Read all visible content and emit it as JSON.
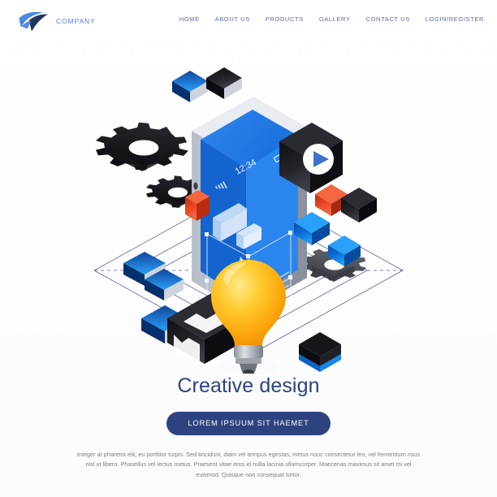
{
  "brand": {
    "logo_icon": "wing-swoosh-logo",
    "name": "COMPANY",
    "logo_color_light": "#3a7de0",
    "logo_color_dark": "#1f3566"
  },
  "nav": {
    "items": [
      {
        "label": "HOME"
      },
      {
        "label": "ABOUT US"
      },
      {
        "label": "PRODUCTS"
      },
      {
        "label": "GALLERY"
      },
      {
        "label": "CONTACT US"
      },
      {
        "label": "LOGIN/REGISTER"
      }
    ]
  },
  "hero": {
    "illustration_name": "isometric-creative-design-phone",
    "phone": {
      "status_time": "12:34",
      "signal_icon": "signal-bars-icon",
      "battery_icon": "battery-icon"
    },
    "objects": [
      {
        "name": "gear-large",
        "color": "#1d1d1f"
      },
      {
        "name": "gear-small",
        "color": "#1d1d1f"
      },
      {
        "name": "gear-right",
        "color": "#4a4a50"
      },
      {
        "name": "card-blue-top",
        "color": "#0b6fd4"
      },
      {
        "name": "card-black-top",
        "color": "#18181c"
      },
      {
        "name": "card-red-left",
        "color": "#e8401f"
      },
      {
        "name": "card-blue-left-1",
        "color": "#0a6ad0"
      },
      {
        "name": "card-blue-left-2",
        "color": "#0a6ad0"
      },
      {
        "name": "card-blue-left-3",
        "color": "#0a6ad0"
      },
      {
        "name": "card-play-video",
        "color": "#18181c"
      },
      {
        "name": "card-red-right",
        "color": "#e8401f"
      },
      {
        "name": "card-black-right",
        "color": "#18181c"
      },
      {
        "name": "card-blue-right",
        "color": "#0a6ad0"
      },
      {
        "name": "card-image-gallery",
        "color": "#18181c"
      },
      {
        "name": "card-blue-stack",
        "color": "#0a6ad0"
      },
      {
        "name": "lightbulb-idea",
        "color": "#ffb412"
      }
    ],
    "grid_color": "#3a4a8c"
  },
  "copy": {
    "headline": "Creative design",
    "cta_label": "LOREM IPSUUM SIT HAEMET",
    "cta_color": "#2d4380",
    "body": "Integer at pharetra elit, eu porttitor turpis. Sed tincidunt, diam vel tempus egestas, metus nunc consectetur leo, vel fermentum risus nisl ut libero. Phasellus vel lectus metus. Praesent vitae eros id nulla lacinia ullamcorper. Maecenas maximus sit amet mi vel euismod. Quisque non consequat tortor."
  }
}
